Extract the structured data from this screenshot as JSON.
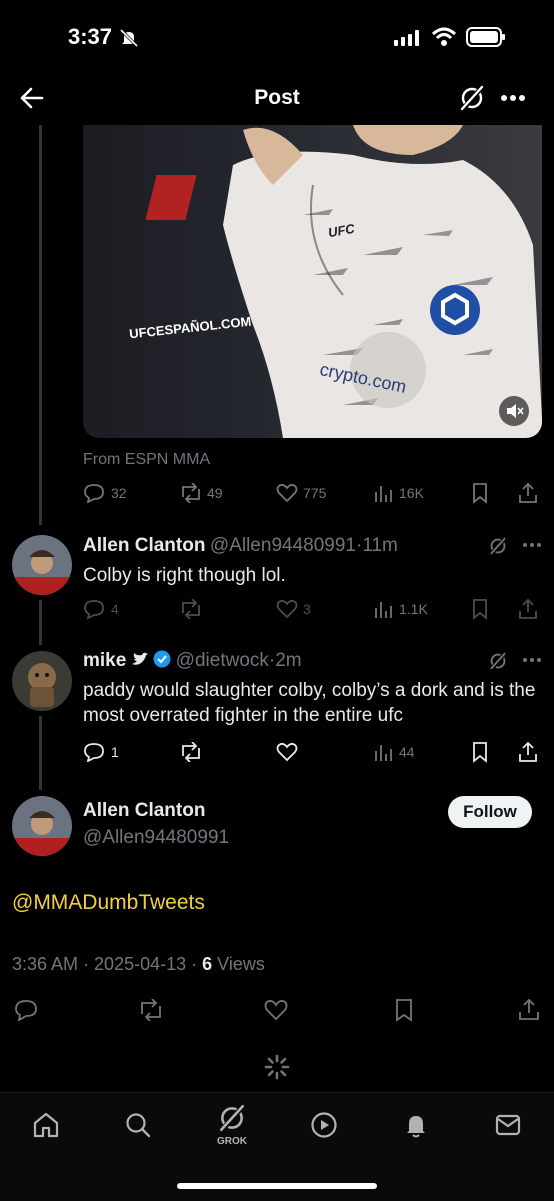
{
  "status_bar": {
    "time": "3:37"
  },
  "header": {
    "title": "Post"
  },
  "media_post": {
    "source": "From ESPN MMA",
    "stats": {
      "replies": "32",
      "reposts": "49",
      "likes": "775",
      "views": "16K"
    }
  },
  "replies": [
    {
      "name": "Allen Clanton",
      "handle": "@Allen94480991",
      "time": "11m",
      "text": "Colby is right though lol.",
      "stats": {
        "replies": "4",
        "reposts": "",
        "likes": "3",
        "views": "1.1K"
      }
    },
    {
      "name": "mike",
      "handle": "@dietwock",
      "time": "2m",
      "text": "paddy would slaughter colby, colby’s a dork and is the most overrated fighter in the entire ufc",
      "stats": {
        "replies": "1",
        "reposts": "",
        "likes": "",
        "views": "44"
      }
    }
  ],
  "main_post": {
    "name": "Allen Clanton",
    "handle": "@Allen94480991",
    "follow_label": "Follow",
    "text": "@MMADumbTweets",
    "time": "3:36 AM",
    "date": "2025-04-13",
    "views_count": "6",
    "views_label": "Views"
  },
  "media_labels": {
    "site": "UFCESPAÑOL.COM",
    "shirt_logo": "UFC",
    "sponsor": "crypto.com"
  },
  "tab_bar": {
    "grok_label": "GROK"
  },
  "colors": {
    "accent_yellow": "#f4d03f",
    "verified_blue": "#1d9bf0",
    "muted": "#71767b"
  }
}
